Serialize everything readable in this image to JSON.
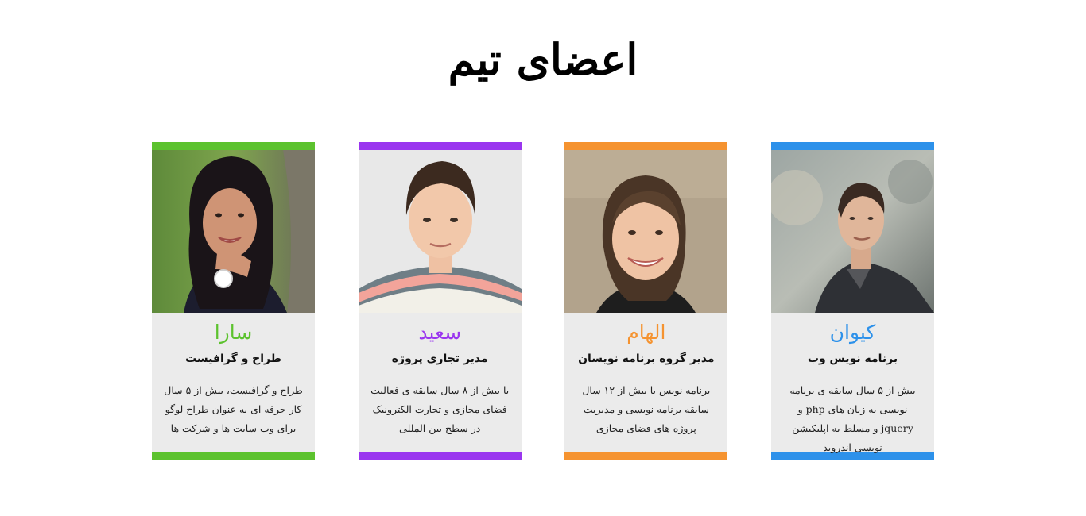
{
  "page": {
    "title": "اعضای تیم"
  },
  "members": [
    {
      "name": "کیوان",
      "role": "برنامه نویس وب",
      "bio": "بیش از ۵ سال سابقه ی برنامه نویسی به زبان های php و jquery و مسلط به اپلیکیشن نویسی اندروید",
      "color": "#2d91ea"
    },
    {
      "name": "الهام",
      "role": "مدیر گروه برنامه نویسان",
      "bio": "برنامه نویس با بیش از ۱۲ سال سابقه برنامه نویسی و مدیریت پروژه های فضای مجازی",
      "color": "#f59330"
    },
    {
      "name": "سعید",
      "role": "مدیر تجاری پروژه",
      "bio": "با بیش از ۸ سال سابقه ی فعالیت فضای مجازی و تجارت الکترونیک در سطح بین المللی",
      "color": "#9a36ef"
    },
    {
      "name": "سارا",
      "role": "طراح و گرافیست",
      "bio": "طراح و گرافیست، بیش از ۵ سال کار حرفه ای به عنوان طراح لوگو برای وب سایت ها و شرکت ها",
      "color": "#5cc22e"
    }
  ]
}
